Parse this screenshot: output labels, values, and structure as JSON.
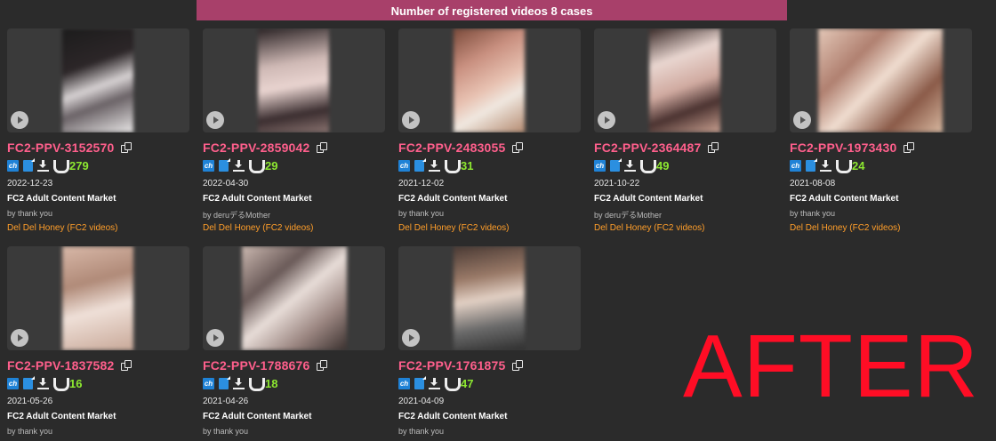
{
  "banner": "Number of registered videos 8 cases",
  "after_text": "AFTER",
  "colors": {
    "accent_banner": "#a8406a",
    "code": "#ff5f8c",
    "count": "#8de830",
    "label": "#ff9e2a",
    "after": "#ff0d25"
  },
  "icons": [
    "ch-icon",
    "bookmark-icon",
    "download-icon",
    "magnet-icon",
    "play-icon",
    "copy-icon"
  ],
  "videos": [
    {
      "code": "FC2-PPV-3152570",
      "count": "279",
      "date": "2022-12-23",
      "title": "FC2 Adult Content Market",
      "author": "by thank you",
      "label": "Del Del Honey (FC2 videos)"
    },
    {
      "code": "FC2-PPV-2859042",
      "count": "29",
      "date": "2022-04-30",
      "title": "FC2 Adult Content Market",
      "author": "by deruデるMother",
      "label": "Del Del Honey (FC2 videos)"
    },
    {
      "code": "FC2-PPV-2483055",
      "count": "31",
      "date": "2021-12-02",
      "title": "FC2 Adult Content Market",
      "author": "by thank you",
      "label": "Del Del Honey (FC2 videos)"
    },
    {
      "code": "FC2-PPV-2364487",
      "count": "49",
      "date": "2021-10-22",
      "title": "FC2 Adult Content Market",
      "author": "by deruデるMother",
      "label": "Del Del Honey (FC2 videos)"
    },
    {
      "code": "FC2-PPV-1973430",
      "count": "24",
      "date": "2021-08-08",
      "title": "FC2 Adult Content Market",
      "author": "by thank you",
      "label": "Del Del Honey (FC2 videos)"
    },
    {
      "code": "FC2-PPV-1837582",
      "count": "16",
      "date": "2021-05-26",
      "title": "FC2 Adult Content Market",
      "author": "by thank you",
      "label": ""
    },
    {
      "code": "FC2-PPV-1788676",
      "count": "18",
      "date": "2021-04-26",
      "title": "FC2 Adult Content Market",
      "author": "by thank you",
      "label": ""
    },
    {
      "code": "FC2-PPV-1761875",
      "count": "47",
      "date": "2021-04-09",
      "title": "FC2 Adult Content Market",
      "author": "by thank you",
      "label": ""
    }
  ]
}
